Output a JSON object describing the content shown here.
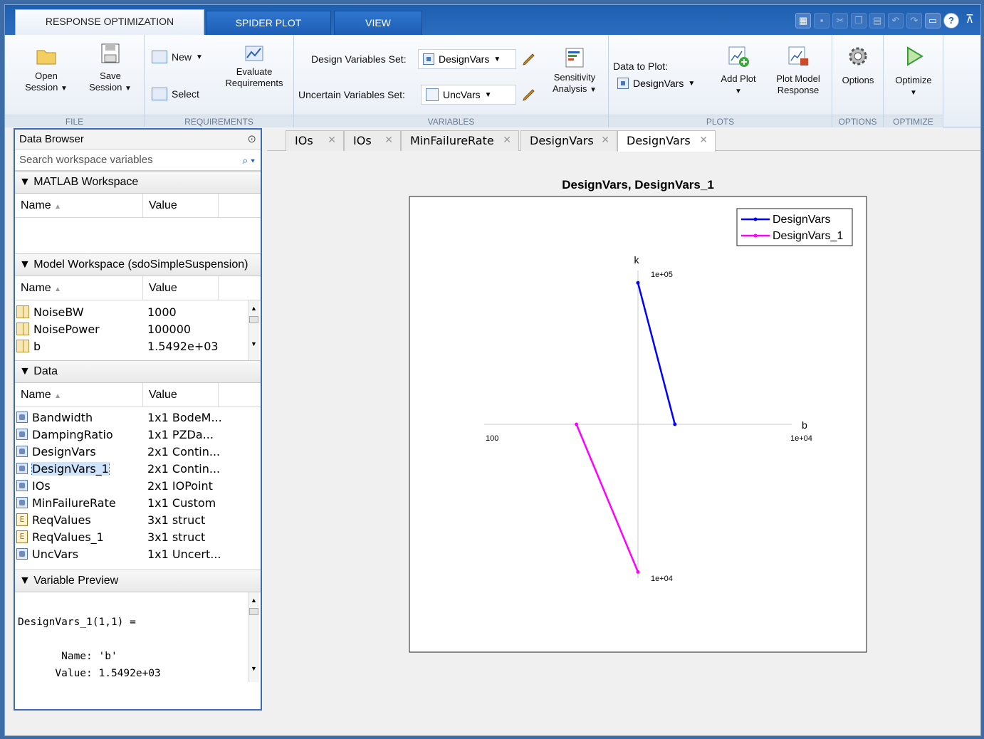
{
  "tabs": [
    "RESPONSE OPTIMIZATION",
    "SPIDER PLOT",
    "VIEW"
  ],
  "ribbon": {
    "file": {
      "title": "FILE",
      "open": "Open",
      "open2": "Session",
      "save": "Save",
      "save2": "Session"
    },
    "requirements": {
      "title": "REQUIREMENTS",
      "new": "New",
      "select": "Select",
      "evaluate": "Evaluate",
      "evaluate2": "Requirements"
    },
    "variables": {
      "title": "VARIABLES",
      "design_label": "Design Variables Set:",
      "design_value": "DesignVars",
      "uncertain_label": "Uncertain Variables Set:",
      "uncertain_value": "UncVars",
      "sensitivity": "Sensitivity",
      "sensitivity2": "Analysis"
    },
    "plots": {
      "title": "PLOTS",
      "data_label": "Data to Plot:",
      "data_value": "DesignVars",
      "add_plot": "Add Plot",
      "plot_model": "Plot Model",
      "plot_model2": "Response"
    },
    "options": {
      "title": "OPTIONS",
      "label": "Options"
    },
    "optimize": {
      "title": "OPTIMIZE",
      "label": "Optimize"
    }
  },
  "browser": {
    "title": "Data Browser",
    "search_placeholder": "Search workspace variables",
    "matlab_ws": "MATLAB Workspace",
    "model_ws": "Model Workspace (sdoSimpleSuspension)",
    "data_section": "Data",
    "preview_section": "Variable Preview",
    "col_name": "Name",
    "col_value": "Value",
    "model_vars": [
      {
        "name": "NoiseBW",
        "value": "1000"
      },
      {
        "name": "NoisePower",
        "value": "100000"
      },
      {
        "name": "b",
        "value": "1.5492e+03"
      }
    ],
    "data_vars": [
      {
        "name": "Bandwidth",
        "value": "1x1 BodeM...",
        "icon": "object-icon"
      },
      {
        "name": "DampingRatio",
        "value": "1x1 PZDa...",
        "icon": "object-icon"
      },
      {
        "name": "DesignVars",
        "value": "2x1 Contin...",
        "icon": "object-icon"
      },
      {
        "name": "DesignVars_1",
        "value": "2x1 Contin...",
        "icon": "object-icon",
        "selected": true
      },
      {
        "name": "IOs",
        "value": "2x1 IOPoint",
        "icon": "object-icon"
      },
      {
        "name": "MinFailureRate",
        "value": "1x1 Custom",
        "icon": "object-icon"
      },
      {
        "name": "ReqValues",
        "value": "3x1 struct",
        "icon": "struct-icon"
      },
      {
        "name": "ReqValues_1",
        "value": "3x1 struct",
        "icon": "struct-icon"
      },
      {
        "name": "UncVars",
        "value": "1x1 Uncert...",
        "icon": "object-icon"
      }
    ],
    "preview_lines": [
      "",
      "DesignVars_1(1,1) =",
      "",
      "       Name: 'b'",
      "      Value: 1.5492e+03"
    ]
  },
  "doc_tabs": [
    "IOs",
    "IOs",
    "MinFailureRate",
    "DesignVars",
    "DesignVars"
  ],
  "chart_data": {
    "type": "line",
    "title": "DesignVars, DesignVars_1",
    "axes": [
      {
        "name": "b",
        "min_label": "100",
        "max_label": "1e+04"
      },
      {
        "name": "k",
        "min_label": "1e+04",
        "max_label": "1e+05"
      }
    ],
    "series": [
      {
        "name": "DesignVars",
        "color": "#0000ff",
        "values": {
          "b": 0.62,
          "k": 0.96
        }
      },
      {
        "name": "DesignVars_1",
        "color": "#ff00ff",
        "values": {
          "b": 0.3,
          "k": 0.02
        }
      }
    ],
    "legend": "top-right"
  }
}
